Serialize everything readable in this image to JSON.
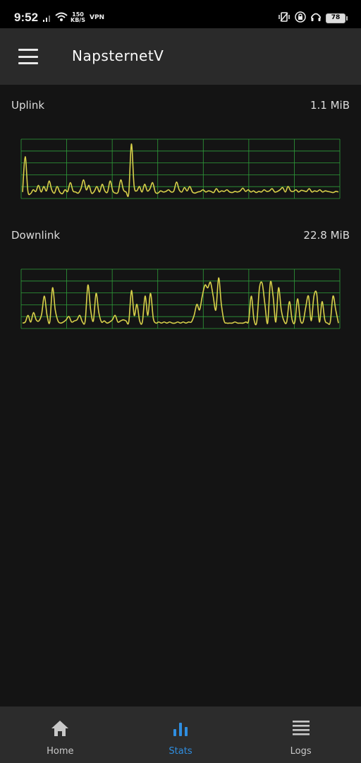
{
  "status_bar": {
    "time": "9:52",
    "net_speed": "150",
    "net_unit": "KB/S",
    "vpn": "VPN",
    "battery": "78"
  },
  "app": {
    "title": "NapsternetV"
  },
  "stats": {
    "uplink": {
      "label": "Uplink",
      "total": "1.1 MiB"
    },
    "downlink": {
      "label": "Downlink",
      "total": "22.8 MiB"
    }
  },
  "chart_data": [
    {
      "type": "line",
      "title": "Uplink",
      "grid": true,
      "line_color": "#d8d04a",
      "grid_color": "#2e9e3a",
      "ylim": [
        0,
        100
      ],
      "values": [
        8,
        72,
        10,
        5,
        12,
        9,
        20,
        8,
        18,
        10,
        28,
        12,
        6,
        18,
        8,
        5,
        12,
        9,
        25,
        10,
        8,
        6,
        14,
        30,
        12,
        20,
        6,
        9,
        18,
        8,
        22,
        10,
        8,
        28,
        10,
        6,
        8,
        30,
        12,
        8,
        6,
        95,
        20,
        10,
        18,
        8,
        22,
        10,
        14,
        25,
        8,
        6,
        10,
        8,
        9,
        12,
        8,
        10,
        26,
        12,
        8,
        16,
        10,
        18,
        8,
        6,
        8,
        9,
        12,
        8,
        10,
        9,
        7,
        14,
        8,
        10,
        9,
        12,
        8,
        7,
        9,
        8,
        10,
        15,
        9,
        12,
        8,
        10,
        7,
        9,
        8,
        12,
        9,
        10,
        14,
        8,
        9,
        12,
        16,
        8,
        18,
        10,
        9,
        12,
        8,
        11,
        10,
        9,
        14,
        8,
        10,
        9,
        12,
        8,
        10,
        9,
        8,
        7,
        9,
        8
      ]
    },
    {
      "type": "line",
      "title": "Downlink",
      "grid": true,
      "line_color": "#d8d04a",
      "grid_color": "#2e9e3a",
      "ylim": [
        0,
        100
      ],
      "values": [
        6,
        8,
        20,
        8,
        25,
        12,
        10,
        22,
        55,
        20,
        8,
        70,
        30,
        10,
        6,
        8,
        12,
        18,
        8,
        10,
        12,
        20,
        8,
        10,
        75,
        30,
        10,
        60,
        25,
        8,
        10,
        6,
        8,
        12,
        20,
        8,
        10,
        12,
        10,
        8,
        65,
        20,
        40,
        10,
        8,
        55,
        20,
        60,
        15,
        6,
        8,
        6,
        8,
        6,
        8,
        6,
        6,
        8,
        6,
        8,
        6,
        8,
        8,
        20,
        40,
        30,
        55,
        75,
        70,
        80,
        55,
        30,
        88,
        40,
        10,
        6,
        6,
        6,
        8,
        6,
        6,
        6,
        8,
        10,
        55,
        12,
        8,
        70,
        78,
        40,
        6,
        80,
        55,
        8,
        70,
        30,
        10,
        8,
        45,
        12,
        8,
        50,
        12,
        8,
        35,
        55,
        10,
        55,
        60,
        8,
        45,
        12,
        6,
        8,
        55,
        30,
        6
      ]
    }
  ],
  "nav": {
    "items": [
      {
        "label": "Home",
        "icon": "home-icon"
      },
      {
        "label": "Stats",
        "icon": "bar-chart-icon"
      },
      {
        "label": "Logs",
        "icon": "list-icon"
      }
    ],
    "active_color": "#2f8ee0"
  }
}
